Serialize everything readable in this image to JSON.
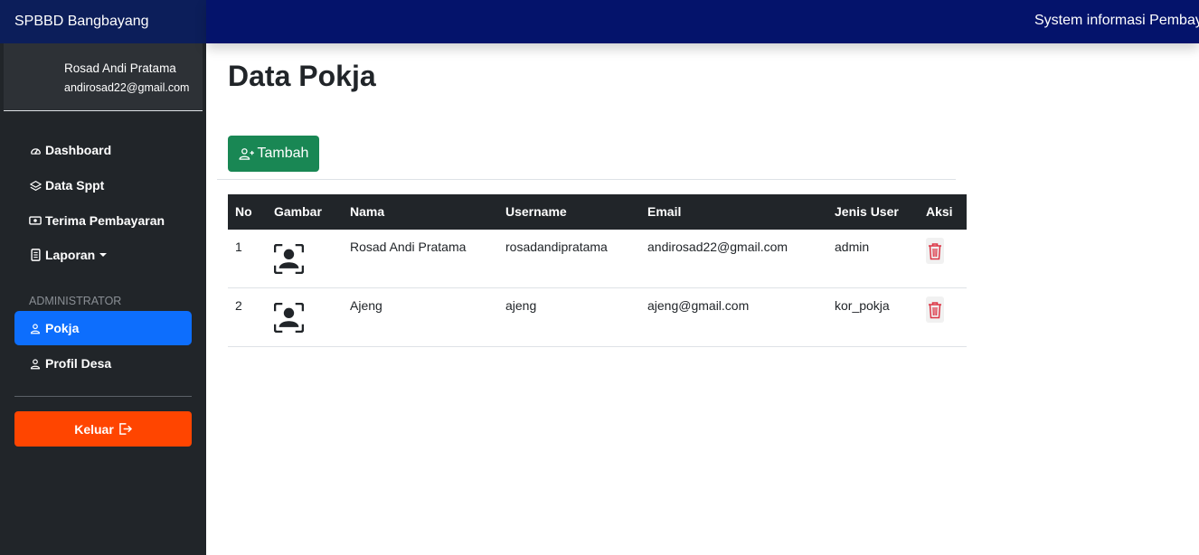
{
  "sidebar": {
    "brand": "SPBBD Bangbayang",
    "user": {
      "name": "Rosad Andi Pratama",
      "email": "andirosad22@gmail.com"
    },
    "nav": [
      {
        "label": "Dashboard",
        "icon": "speedometer-icon"
      },
      {
        "label": "Data Sppt",
        "icon": "layers-icon"
      },
      {
        "label": "Terima Pembayaran",
        "icon": "cash-icon"
      },
      {
        "label": "Laporan",
        "icon": "file-icon"
      }
    ],
    "section_label": "ADMINISTRATOR",
    "admin_nav": [
      {
        "label": "Pokja",
        "icon": "person-icon",
        "active": true
      },
      {
        "label": "Profil Desa",
        "icon": "person-icon",
        "active": false
      }
    ],
    "logout_label": "Keluar"
  },
  "topbar": {
    "text": "System informasi Pembay"
  },
  "main": {
    "title": "Data Pokja",
    "add_button_label": "Tambah",
    "table": {
      "headers": [
        "No",
        "Gambar",
        "Nama",
        "Username",
        "Email",
        "Jenis User",
        "Aksi"
      ],
      "rows": [
        {
          "no": "1",
          "nama": "Rosad Andi Pratama",
          "username": "rosadandipratama",
          "email": "andirosad22@gmail.com",
          "jenis": "admin"
        },
        {
          "no": "2",
          "nama": "Ajeng",
          "username": "ajeng",
          "email": "ajeng@gmail.com",
          "jenis": "kor_pokja"
        }
      ]
    }
  },
  "colors": {
    "sidebar_bg": "#212529",
    "brand_bg": "#0c1e5a",
    "topbar_bg": "#04136b",
    "active_nav": "#0d6efd",
    "logout_bg": "#ff4500",
    "add_button_bg": "#198754",
    "delete_icon": "#dc3545"
  }
}
